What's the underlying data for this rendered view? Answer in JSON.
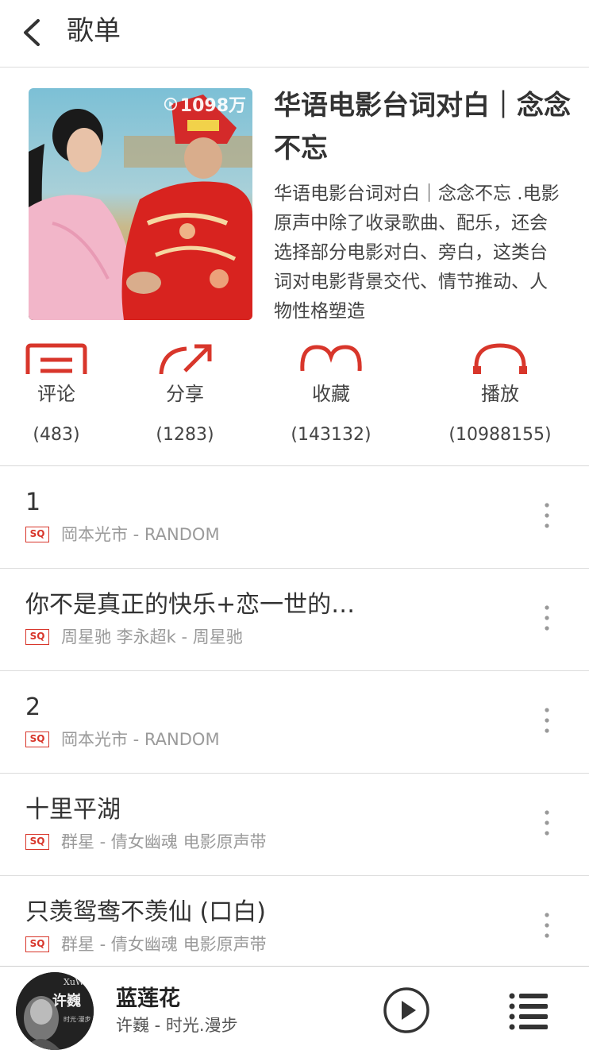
{
  "nav": {
    "title": "歌单"
  },
  "playlist": {
    "play_count": "1098万",
    "title": "华语电影台词对白｜念念不忘",
    "description": "华语电影台词对白｜念念不忘 .电影原声中除了收录歌曲、配乐，还会选择部分电影对白、旁白，这类台词对电影背景交代、情节推动、人物性格塑造"
  },
  "actions": [
    {
      "label": "评论",
      "count": "(483)",
      "icon": "comment-icon"
    },
    {
      "label": "分享",
      "count": "(1283)",
      "icon": "share-icon"
    },
    {
      "label": "收藏",
      "count": "(143132)",
      "icon": "heart-icon"
    },
    {
      "label": "播放",
      "count": "(10988155)",
      "icon": "headphones-icon"
    }
  ],
  "quality_badge": "SQ",
  "songs": [
    {
      "title": "1",
      "artist": "岡本光市 - RANDOM"
    },
    {
      "title": "你不是真正的快乐+恋一世的…",
      "artist": "周星驰 李永超k - 周星驰"
    },
    {
      "title": "2",
      "artist": "岡本光市 - RANDOM"
    },
    {
      "title": "十里平湖",
      "artist": "群星 - 倩女幽魂 电影原声带"
    },
    {
      "title": "只羡鸳鸯不羡仙 (口白)",
      "artist": "群星 - 倩女幽魂 电影原声带"
    }
  ],
  "player": {
    "title": "蓝莲花",
    "artist": "许巍 - 时光.漫步",
    "cover_text_main": "许巍",
    "cover_text_top": "XuWei",
    "cover_text_side": "时光·漫步"
  },
  "colors": {
    "accent": "#d8362b",
    "text": "#333333",
    "muted": "#9a9a9a",
    "divider": "#dcdcdc"
  }
}
